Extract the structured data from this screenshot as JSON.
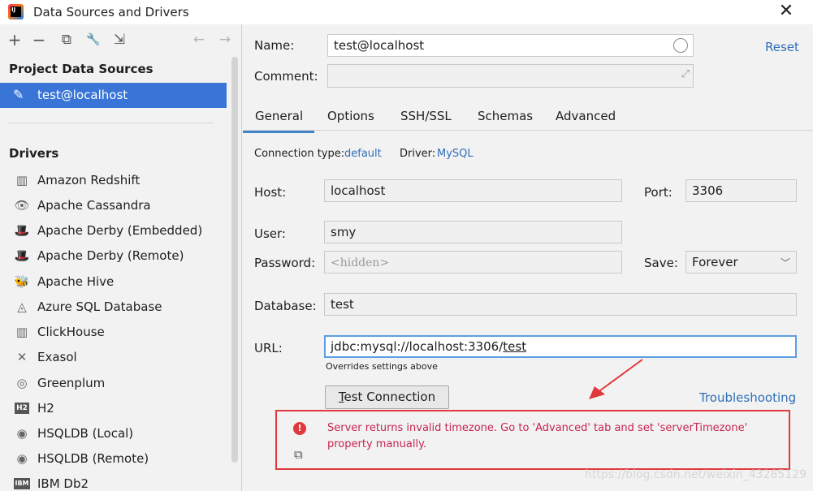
{
  "window": {
    "title": "Data Sources and Drivers",
    "app_icon_text": "IJ"
  },
  "toolbar": {
    "add": "+",
    "remove": "−",
    "copy": "⧉",
    "settings": "🔧",
    "import": "⇲",
    "back": "←",
    "forward": "→"
  },
  "left": {
    "project_header": "Project Data Sources",
    "selected_source": "test@localhost",
    "drivers_header": "Drivers",
    "drivers": [
      {
        "label": "Amazon Redshift",
        "icon": "▥"
      },
      {
        "label": "Apache Cassandra",
        "icon": "👁"
      },
      {
        "label": "Apache Derby (Embedded)",
        "icon": "🎩"
      },
      {
        "label": "Apache Derby (Remote)",
        "icon": "🎩"
      },
      {
        "label": "Apache Hive",
        "icon": "🐝"
      },
      {
        "label": "Azure SQL Database",
        "icon": "◬"
      },
      {
        "label": "ClickHouse",
        "icon": "▥"
      },
      {
        "label": "Exasol",
        "icon": "✕"
      },
      {
        "label": "Greenplum",
        "icon": "◎"
      },
      {
        "label": "H2",
        "icon": "H2"
      },
      {
        "label": "HSQLDB (Local)",
        "icon": "◉"
      },
      {
        "label": "HSQLDB (Remote)",
        "icon": "◉"
      },
      {
        "label": "IBM Db2",
        "icon": "IBM"
      }
    ]
  },
  "form": {
    "name_label": "Name:",
    "name_value": "test@localhost",
    "comment_label": "Comment:",
    "comment_value": "",
    "reset": "Reset",
    "tabs": [
      "General",
      "Options",
      "SSH/SSL",
      "Schemas",
      "Advanced"
    ],
    "connection_type_label": "Connection type:",
    "connection_type_value": "default",
    "driver_label": "Driver:",
    "driver_value": "MySQL",
    "host_label": "Host:",
    "host_value": "localhost",
    "port_label": "Port:",
    "port_value": "3306",
    "user_label": "User:",
    "user_value": "smy",
    "password_label": "Password:",
    "password_placeholder": "<hidden>",
    "save_label": "Save:",
    "save_value": "Forever",
    "database_label": "Database:",
    "database_value": "test",
    "url_label": "URL:",
    "url_prefix": "jdbc:mysql://localhost:3306/",
    "url_db": "test",
    "url_hint": "Overrides settings above",
    "test_button_first": "T",
    "test_button_rest": "est Connection",
    "troubleshooting": "Troubleshooting",
    "error_message": "Server returns invalid timezone. Go to 'Advanced' tab and set 'serverTimezone' property manually."
  },
  "colors": {
    "selection": "#3875d6",
    "link": "#2f6fb7",
    "error": "#c7254e",
    "annotation": "#e0393d"
  },
  "watermark": "https://blog.csdn.net/weixin_43285129"
}
